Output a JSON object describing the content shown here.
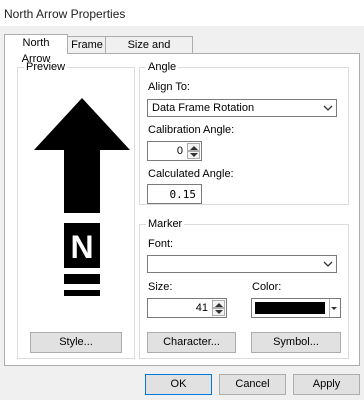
{
  "window": {
    "title": "North Arrow Properties"
  },
  "tabs": [
    {
      "label": "North Arrow",
      "active": true
    },
    {
      "label": "Frame",
      "active": false
    },
    {
      "label": "Size and Position",
      "active": false
    }
  ],
  "preview": {
    "group_label": "Preview",
    "style_button": "Style...",
    "letter": "N"
  },
  "angle": {
    "group_label": "Angle",
    "align_to_label": "Align To:",
    "align_to_value": "Data Frame Rotation",
    "calibration_label": "Calibration Angle:",
    "calibration_value": "0",
    "calculated_label": "Calculated Angle:",
    "calculated_value": "0.15"
  },
  "marker": {
    "group_label": "Marker",
    "font_label": "Font:",
    "font_value": "",
    "size_label": "Size:",
    "size_value": "41",
    "color_label": "Color:",
    "color_value": "#000000",
    "character_button": "Character...",
    "symbol_button": "Symbol..."
  },
  "footer": {
    "ok": "OK",
    "cancel": "Cancel",
    "apply": "Apply"
  },
  "icons": {
    "dropdown": "chevron-down-icon",
    "spin_up": "triangle-up-icon",
    "spin_down": "triangle-down-icon"
  }
}
